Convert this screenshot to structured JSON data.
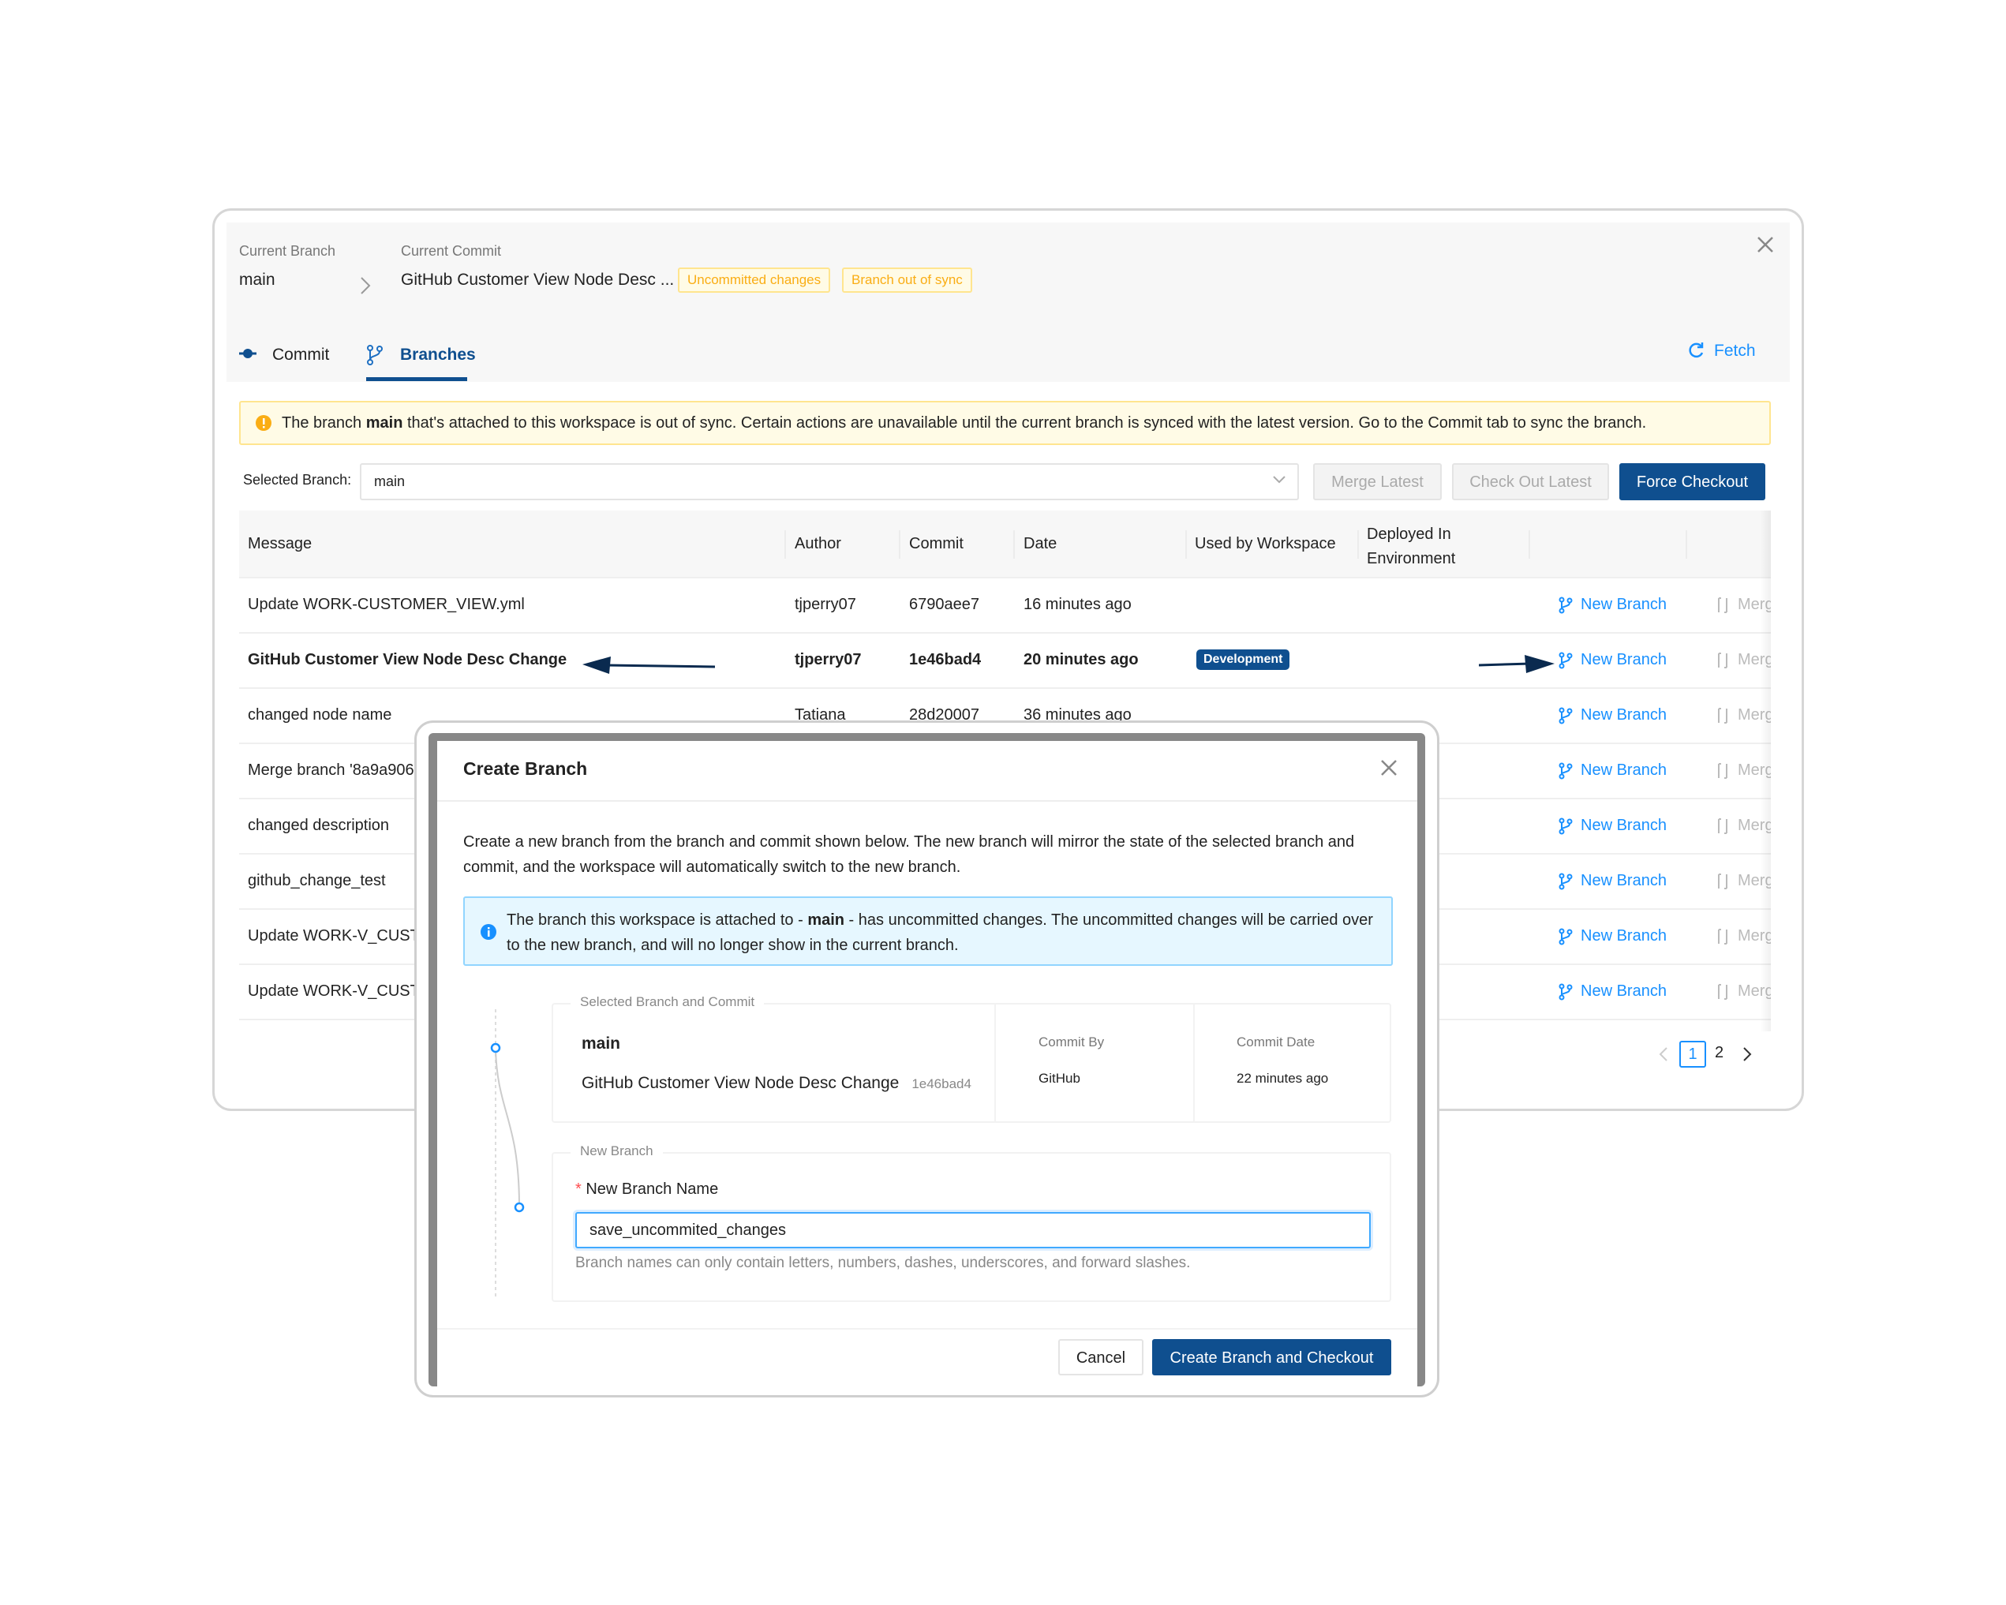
{
  "header": {
    "current_branch_label": "Current Branch",
    "current_branch": "main",
    "current_commit_label": "Current Commit",
    "current_commit": "GitHub Customer View Node Desc ...",
    "badges": [
      "Uncommitted changes",
      "Branch out of sync"
    ]
  },
  "tabs": [
    {
      "label": "Commit",
      "active": false
    },
    {
      "label": "Branches",
      "active": true
    }
  ],
  "fetch_label": "Fetch",
  "banner": {
    "pre": "The branch ",
    "branch": "main",
    "post": " that's attached to this workspace is out of sync. Certain actions are unavailable until the current branch is synced with the latest version. Go to the Commit tab to sync the branch."
  },
  "selector": {
    "label": "Selected Branch:",
    "value": "main",
    "merge_latest": "Merge Latest",
    "check_out_latest": "Check Out Latest",
    "force_checkout": "Force Checkout"
  },
  "table": {
    "columns": [
      "Message",
      "Author",
      "Commit",
      "Date",
      "Used by Workspace",
      "Deployed In",
      "Environment"
    ],
    "new_branch_label": "New Branch",
    "merge_label": "Merg",
    "rows": [
      {
        "message": "Update WORK-CUSTOMER_VIEW.yml",
        "author": "tjperry07",
        "commit": "6790aee7",
        "date": "16 minutes ago",
        "workspace": ""
      },
      {
        "message": "GitHub Customer View Node Desc Change",
        "author": "tjperry07",
        "commit": "1e46bad4",
        "date": "20 minutes ago",
        "workspace": "Development"
      },
      {
        "message": "changed node name",
        "author": "Tatiana",
        "commit": "28d20007",
        "date": "36 minutes ago",
        "workspace": ""
      },
      {
        "message": "Merge branch '8a9a906",
        "author": "",
        "commit": "",
        "date": "",
        "workspace": ""
      },
      {
        "message": "changed description",
        "author": "",
        "commit": "",
        "date": "",
        "workspace": ""
      },
      {
        "message": "github_change_test",
        "author": "",
        "commit": "",
        "date": "",
        "workspace": ""
      },
      {
        "message": "Update WORK-V_CUSTO",
        "author": "",
        "commit": "",
        "date": "",
        "workspace": ""
      },
      {
        "message": "Update WORK-V_CUSTO",
        "author": "",
        "commit": "",
        "date": "",
        "workspace": ""
      }
    ]
  },
  "pagination": {
    "current": "1",
    "pages": [
      "1",
      "2"
    ]
  },
  "modal": {
    "title": "Create Branch",
    "description": "Create a new branch from the branch and commit shown below. The new branch will mirror the state of the selected branch and commit, and the workspace will automatically switch to the new branch.",
    "info": {
      "pre": "The branch this workspace is attached to - ",
      "branch": "main",
      "post": " - has uncommitted changes. The uncommitted changes will be carried over to the new branch, and will no longer show in the current branch."
    },
    "selected_legend": "Selected Branch and Commit",
    "branch": "main",
    "commit_message": "GitHub Customer View Node Desc Change",
    "commit_hash": "1e46bad4",
    "commit_by_label": "Commit By",
    "commit_by": "GitHub",
    "commit_date_label": "Commit Date",
    "commit_date": "22 minutes ago",
    "new_legend": "New Branch",
    "field_label": "New Branch Name",
    "field_value": "save_uncommited_changes",
    "help": "Branch names can only contain letters, numbers, dashes, underscores, and forward slashes.",
    "cancel": "Cancel",
    "submit": "Create Branch and Checkout"
  },
  "colors": {
    "primary": "#0f4f8f",
    "link": "#1890ff",
    "warning": "#faad14"
  }
}
